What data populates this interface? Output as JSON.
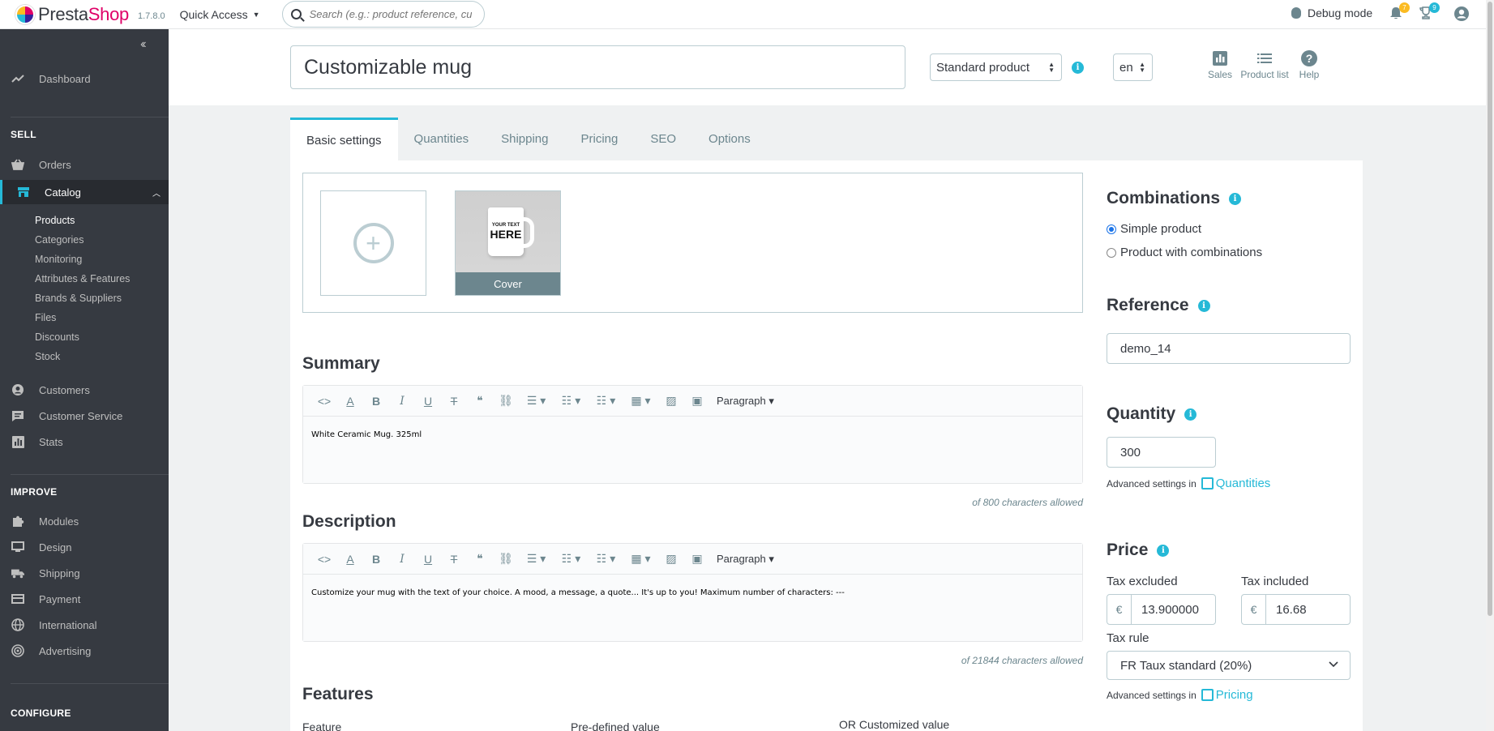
{
  "header": {
    "logo_part1": "Presta",
    "logo_part2": "Shop",
    "version": "1.7.8.0",
    "quick_access": "Quick Access",
    "search_placeholder": "Search (e.g.: product reference, custon",
    "debug_mode": "Debug mode",
    "notifications_count": "7",
    "trophy_count": "9"
  },
  "sidebar": {
    "dashboard": "Dashboard",
    "sell_title": "SELL",
    "orders": "Orders",
    "catalog": "Catalog",
    "catalog_sub": [
      "Products",
      "Categories",
      "Monitoring",
      "Attributes & Features",
      "Brands & Suppliers",
      "Files",
      "Discounts",
      "Stock"
    ],
    "customers": "Customers",
    "customer_service": "Customer Service",
    "stats": "Stats",
    "improve_title": "IMPROVE",
    "modules": "Modules",
    "design": "Design",
    "shipping": "Shipping",
    "payment": "Payment",
    "international": "International",
    "advertising": "Advertising",
    "configure_title": "CONFIGURE"
  },
  "product": {
    "name": "Customizable mug",
    "type": "Standard product",
    "lang": "en",
    "btn_sales": "Sales",
    "btn_product_list": "Product list",
    "btn_help": "Help"
  },
  "tabs": [
    "Basic settings",
    "Quantities",
    "Shipping",
    "Pricing",
    "SEO",
    "Options"
  ],
  "images": {
    "mug_text1": "YOUR TEXT",
    "mug_text2": "HERE",
    "cover_label": "Cover"
  },
  "summary": {
    "title": "Summary",
    "paragraph": "Paragraph",
    "text": "White Ceramic Mug. 325ml",
    "count": "of 800 characters allowed"
  },
  "description": {
    "title": "Description",
    "paragraph": "Paragraph",
    "text": "Customize your mug with the text of your choice. A mood, a message, a quote... It's up to you! Maximum number of characters: ---",
    "count": "of 21844 characters allowed"
  },
  "features": {
    "title": "Features",
    "col_feature": "Feature",
    "col_predefined": "Pre-defined value",
    "col_custom": "OR Customized value"
  },
  "right": {
    "combinations_title": "Combinations",
    "simple_product": "Simple product",
    "with_combinations": "Product with combinations",
    "reference_title": "Reference",
    "reference_value": "demo_14",
    "quantity_title": "Quantity",
    "quantity_value": "300",
    "advanced_text": "Advanced settings in",
    "quantities_link": "Quantities",
    "price_title": "Price",
    "tax_excluded": "Tax excluded",
    "tax_included": "Tax included",
    "currency": "€",
    "price_excl": "13.900000",
    "price_incl": "16.68",
    "tax_rule_label": "Tax rule",
    "tax_rule_value": "FR Taux standard (20%)",
    "pricing_link": "Pricing"
  },
  "colors": {
    "accent": "#25b9d7",
    "sidebar_bg": "#363a41",
    "brand_pink": "#df0067"
  }
}
